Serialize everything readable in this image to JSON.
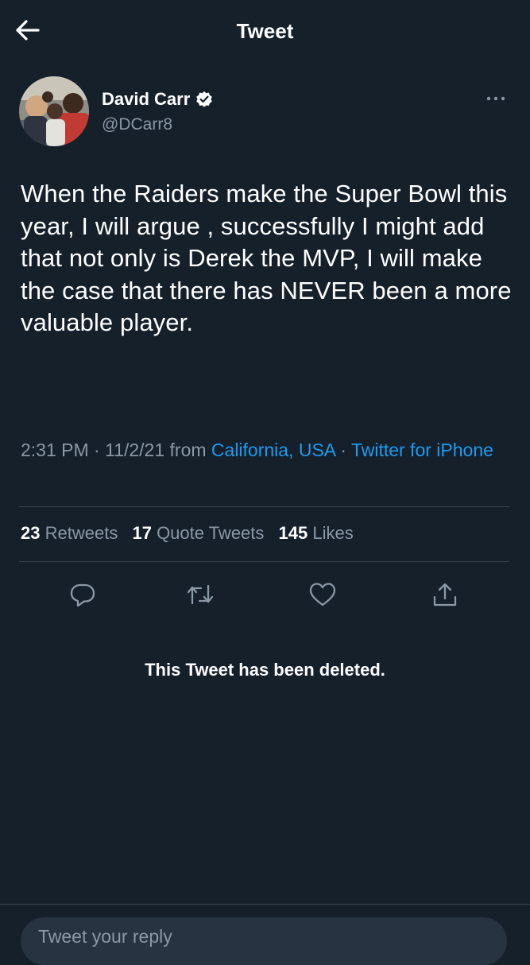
{
  "header": {
    "title": "Tweet",
    "back_icon": "arrow-left-icon"
  },
  "author": {
    "name": "David Carr",
    "handle": "@DCarr8",
    "verified_icon": "verified-badge-icon",
    "avatar_icon": "avatar-photo"
  },
  "tweet": {
    "text": "When the Raiders make the Super Bowl this year, I will argue , successfully I might add that not only is Derek the MVP, I will make the case that there has NEVER been a more valuable player.",
    "time": "2:31 PM",
    "date": "11/2/21",
    "from_label": "from",
    "location": "California, USA",
    "source": "Twitter for iPhone",
    "separator": "·"
  },
  "stats": [
    {
      "count": "23",
      "label": "Retweets"
    },
    {
      "count": "17",
      "label": "Quote Tweets"
    },
    {
      "count": "145",
      "label": "Likes"
    }
  ],
  "actions": [
    "reply-icon",
    "retweet-icon",
    "like-icon",
    "share-icon"
  ],
  "deleted_notice": "This Tweet has been deleted.",
  "reply": {
    "placeholder": "Tweet your reply"
  },
  "colors": {
    "background": "#15202b",
    "accent": "#1d9bf0",
    "muted": "#8b98a5",
    "divider": "#38444d"
  }
}
